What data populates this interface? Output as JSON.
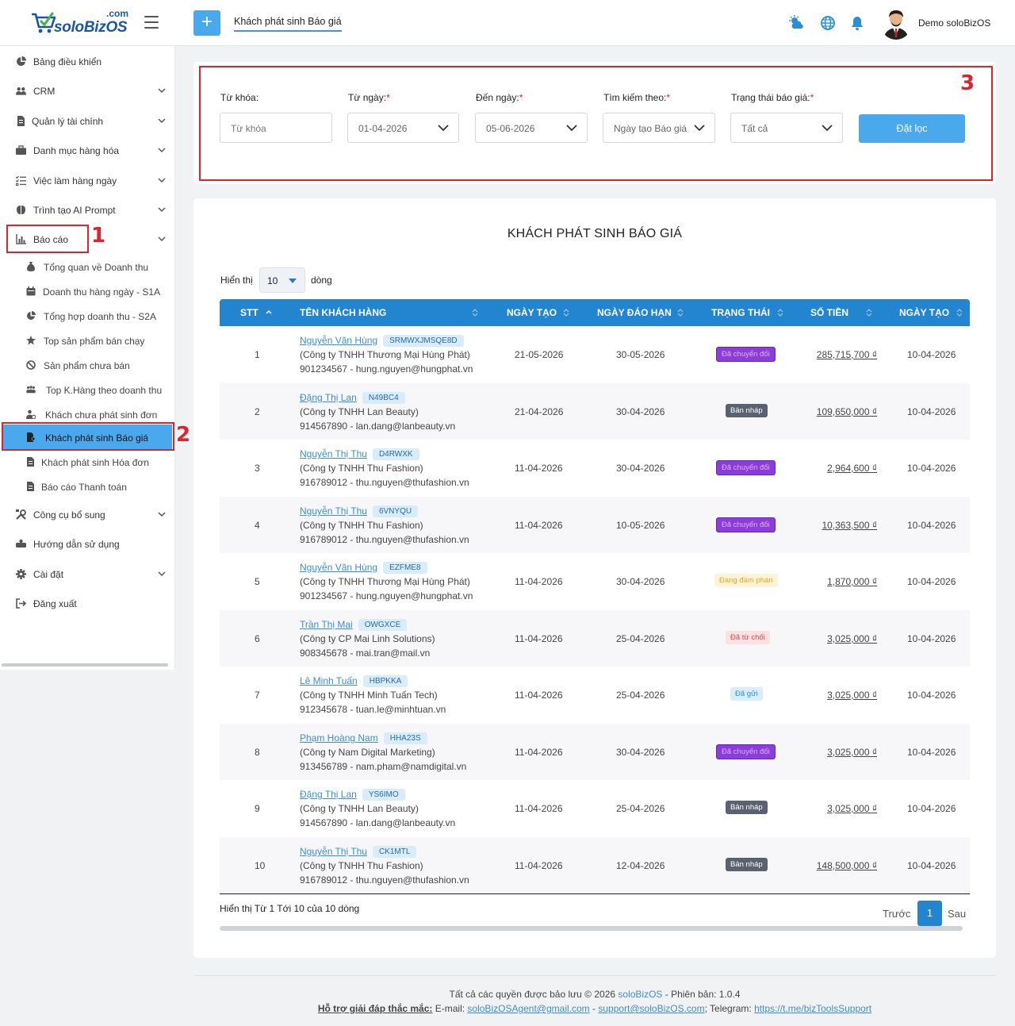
{
  "header": {
    "logo_dotcom": ".com",
    "logo_word": "soloBizOS",
    "tab_title": "Khách phát sinh Báo giá",
    "username": "Demo soloBizOS"
  },
  "sidebar": {
    "items": [
      {
        "label": "Bảng điều khiển"
      },
      {
        "label": "CRM"
      },
      {
        "label": "Quản lý tài chính"
      },
      {
        "label": "Danh mục hàng hóa"
      },
      {
        "label": "Việc làm hàng ngày"
      },
      {
        "label": "Trình tạo AI Prompt"
      },
      {
        "label": "Báo cáo"
      },
      {
        "label": "Công cụ bổ sung"
      },
      {
        "label": "Hướng dẫn sử dụng"
      },
      {
        "label": "Cài đặt"
      },
      {
        "label": "Đăng xuất"
      }
    ],
    "sub_items": [
      {
        "label": "Tổng quan về Doanh thu"
      },
      {
        "label": "Doanh thu hàng ngày - S1A"
      },
      {
        "label": "Tổng hợp doanh thu - S2A"
      },
      {
        "label": "Top sản phẩm bán chạy"
      },
      {
        "label": "Sản phẩm chưa bán"
      },
      {
        "label": "Top K.Hàng theo doanh thu"
      },
      {
        "label": "Khách chưa phát sinh đơn"
      },
      {
        "label": "Khách phát sinh Báo giá"
      },
      {
        "label": "Khách phát sinh Hóa đơn"
      },
      {
        "label": "Báo cáo Thanh toán"
      }
    ]
  },
  "annotations": {
    "n1": "1",
    "n2": "2",
    "n3": "3"
  },
  "filters": {
    "keyword_label": "Từ khóa:",
    "keyword_placeholder": "Từ khóa",
    "from_label": "Từ ngày:",
    "from_value": "01-04-2026",
    "to_label": "Đến ngày:",
    "to_value": "05-06-2026",
    "searchby_label": "Tìm kiếm theo:",
    "searchby_value": "Ngày tạo Báo giá",
    "status_label": "Trạng thái báo giá:",
    "status_value": "Tất cả",
    "required_mark": "*",
    "apply_label": "Đặt lọc"
  },
  "report": {
    "title": "KHÁCH PHÁT SINH BÁO GIÁ",
    "show_label": "Hiển thị",
    "page_size": "10",
    "rows_label": "dòng",
    "columns": [
      "STT",
      "TÊN KHÁCH HÀNG",
      "NGÀY TẠO",
      "NGÀY ĐÁO HẠN",
      "TRẠNG THÁI",
      "SỐ TIỀN",
      "NGÀY TẠO"
    ],
    "rows": [
      {
        "stt": "1",
        "name": "Nguyễn Văn Hùng",
        "code": "SRMWXJMSQE8D",
        "company": "(Công ty TNHH Thương Mại Hùng Phát)",
        "contact": "901234567 - hung.nguyen@hungphat.vn",
        "created": "21-05-2026",
        "due": "30-05-2026",
        "status": "Đã chuyển đổi",
        "status_type": "converted",
        "amount": "285,715,700 ₫",
        "created2": "10-04-2026"
      },
      {
        "stt": "2",
        "name": "Đặng Thị Lan",
        "code": "N49BC4",
        "company": "(Công ty TNHH Lan Beauty)",
        "contact": "914567890 - lan.dang@lanbeauty.vn",
        "created": "21-04-2026",
        "due": "30-04-2026",
        "status": "Bản nháp",
        "status_type": "draft",
        "amount": "109,650,000 ₫",
        "created2": "10-04-2026"
      },
      {
        "stt": "3",
        "name": "Nguyễn Thị Thu",
        "code": "D4RWXK",
        "company": "(Công ty TNHH Thu Fashion)",
        "contact": "916789012 - thu.nguyen@thufashion.vn",
        "created": "11-04-2026",
        "due": "30-04-2026",
        "status": "Đã chuyển đổi",
        "status_type": "converted",
        "amount": "2,964,600 ₫",
        "created2": "10-04-2026"
      },
      {
        "stt": "4",
        "name": "Nguyễn Thị Thu",
        "code": "6VNYQU",
        "company": "(Công ty TNHH Thu Fashion)",
        "contact": "916789012 - thu.nguyen@thufashion.vn",
        "created": "11-04-2026",
        "due": "10-05-2026",
        "status": "Đã chuyển đổi",
        "status_type": "converted",
        "amount": "10,363,500 ₫",
        "created2": "10-04-2026"
      },
      {
        "stt": "5",
        "name": "Nguyễn Văn Hùng",
        "code": "EZFME8",
        "company": "(Công ty TNHH Thương Mại Hùng Phát)",
        "contact": "901234567 - hung.nguyen@hungphat.vn",
        "created": "11-04-2026",
        "due": "30-04-2026",
        "status": "Đang đàm phán",
        "status_type": "negotiating",
        "amount": "1,870,000 ₫",
        "created2": "10-04-2026"
      },
      {
        "stt": "6",
        "name": "Trần Thị Mai",
        "code": "OWGXCE",
        "company": "(Công ty CP Mai Linh Solutions)",
        "contact": "908345678 - mai.tran@mail.vn",
        "created": "11-04-2026",
        "due": "25-04-2026",
        "status": "Đã từ chối",
        "status_type": "rejected",
        "amount": "3,025,000 ₫",
        "created2": "10-04-2026"
      },
      {
        "stt": "7",
        "name": "Lê Minh Tuấn",
        "code": "HBPKKA",
        "company": "(Công ty TNHH Minh Tuấn Tech)",
        "contact": "912345678 - tuan.le@minhtuan.vn",
        "created": "11-04-2026",
        "due": "25-04-2026",
        "status": "Đã gửi",
        "status_type": "sent",
        "amount": "3,025,000 ₫",
        "created2": "10-04-2026"
      },
      {
        "stt": "8",
        "name": "Phạm Hoàng Nam",
        "code": "HHA23S",
        "company": "(Công ty Nam Digital Marketing)",
        "contact": "913456789 - nam.pham@namdigital.vn",
        "created": "11-04-2026",
        "due": "30-04-2026",
        "status": "Đã chuyển đổi",
        "status_type": "converted",
        "amount": "3,025,000 ₫",
        "created2": "10-04-2026"
      },
      {
        "stt": "9",
        "name": "Đặng Thị Lan",
        "code": "YS6IMO",
        "company": "(Công ty TNHH Lan Beauty)",
        "contact": "914567890 - lan.dang@lanbeauty.vn",
        "created": "11-04-2026",
        "due": "25-04-2026",
        "status": "Bản nháp",
        "status_type": "draft",
        "amount": "3,025,000 ₫",
        "created2": "10-04-2026"
      },
      {
        "stt": "10",
        "name": "Nguyễn Thị Thu",
        "code": "CK1MTL",
        "company": "(Công ty TNHH Thu Fashion)",
        "contact": "916789012 - thu.nguyen@thufashion.vn",
        "created": "11-04-2026",
        "due": "12-04-2026",
        "status": "Bản nháp",
        "status_type": "draft",
        "amount": "148,500,000 ₫",
        "created2": "10-04-2026"
      }
    ],
    "footer_info": "Hiển thị Từ 1 Tới 10 của 10 dòng",
    "prev_label": "Trước",
    "current_page": "1",
    "next_label": "Sau"
  },
  "footer": {
    "rights_prefix": "Tất cả các quyền được bảo lưu © 2026 ",
    "brand": "soloBizOS",
    "version": " - Phiên bản: 1.0.4",
    "support_label": "Hỗ trợ giải đáp thắc mắc:",
    "email_label": " E-mail: ",
    "email1": "soloBizOSAgent@gmail.com",
    "sep": " - ",
    "email2": "support@soloBizOS.com",
    "telegram_label": "; Telegram: ",
    "telegram": "https://t.me/bizToolsSupport"
  },
  "colors": {
    "primary": "#2385cf",
    "accent": "#4aa8ec",
    "annotation_red": "#d9262c",
    "status_converted": "#8d3bdb",
    "status_draft": "#5a6270",
    "status_negotiating": "#fdf3d6",
    "status_rejected": "#fbe1e1",
    "status_sent": "#d8eefb"
  },
  "icons": {
    "weather": "cloud-sun-icon",
    "language": "globe-icon",
    "notifications": "bell-icon"
  }
}
